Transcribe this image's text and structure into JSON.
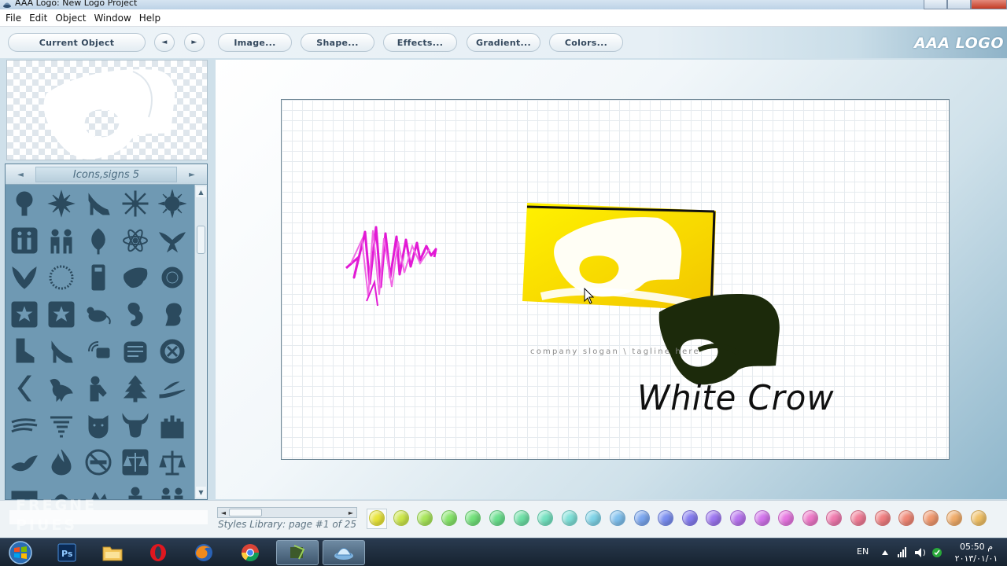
{
  "window": {
    "title": "AAA Logo: New Logo Project"
  },
  "menu": {
    "items": [
      "File",
      "Edit",
      "Object",
      "Window",
      "Help"
    ]
  },
  "toolbar": {
    "current_object": "Current Object",
    "prev": "◄",
    "next": "►",
    "image": "Image...",
    "shape": "Shape...",
    "effects": "Effects...",
    "gradient": "Gradient...",
    "colors": "Colors...",
    "brand": "AAA LOGO"
  },
  "library": {
    "prev": "◄",
    "next": "►",
    "category": "Icons,signs 5",
    "scroll_up": "▲",
    "scroll_down": "▼",
    "icons": [
      "tree-icon",
      "flower-icon",
      "high-heel-icon",
      "snowflake-icon",
      "sun-icon",
      "family-icon",
      "people-icon",
      "leaf-icon",
      "atom-icon",
      "eagle-icon",
      "crest-icon",
      "wreath-icon",
      "phone-icon",
      "thundercats-icon",
      "gear-circle-icon",
      "star-badge-icon",
      "star-badge-icon",
      "mouse-icon",
      "seahorse-icon",
      "squirrel-icon",
      "boot-icon",
      "high-heel-icon",
      "satellite-icon",
      "hand-icon",
      "circle-emblem-icon",
      "chevron-icon",
      "running-bird-icon",
      "sitting-person-icon",
      "christmas-tree-icon",
      "swoosh-icon",
      "speed-lines-icon",
      "tornado-icon",
      "tiger-face-icon",
      "bull-face-icon",
      "castle-icon",
      "bird-icon",
      "fire-icon",
      "no-smoking-icon",
      "scales-badge-icon",
      "scales-icon",
      "pattern-icon",
      "dog-icon",
      "mountain-icon",
      "person-icon",
      "people-icon"
    ]
  },
  "canvas": {
    "slogan": "company slogan \\ tagline here",
    "company_name": "White Crow",
    "colors": {
      "yellow": "#f5d90a",
      "dark_green": "#1c2a0b",
      "magenta": "#e21ad5"
    }
  },
  "bottom": {
    "scroll_left": "◄",
    "scroll_right": "►",
    "styles_page": "Styles Library: page #1 of 25",
    "swatches": [
      "#e9e53a",
      "#cce74a",
      "#a8e65a",
      "#86e56a",
      "#72e27a",
      "#6ae08e",
      "#6ee0a6",
      "#74e2c0",
      "#7ee0d8",
      "#7fd4e8",
      "#7fc0ee",
      "#7aa6ef",
      "#7a8ef0",
      "#857cf0",
      "#9c76f0",
      "#b874ef",
      "#d274ec",
      "#e676e0",
      "#ee78c8",
      "#f07aae",
      "#f07c96",
      "#f07e80",
      "#f08876",
      "#f0986e",
      "#f0ac6a",
      "#f0c066"
    ]
  },
  "watermark": {
    "line1": "FREGNE",
    "line2": "PIUES"
  },
  "taskbar": {
    "apps": [
      "start-orb",
      "photoshop",
      "file-explorer",
      "opera",
      "firefox",
      "chrome",
      "media-app",
      "aaa-logo"
    ],
    "lang": "EN",
    "time": "05:50 م",
    "date": "٢٠١٣/٠١/٠١"
  }
}
